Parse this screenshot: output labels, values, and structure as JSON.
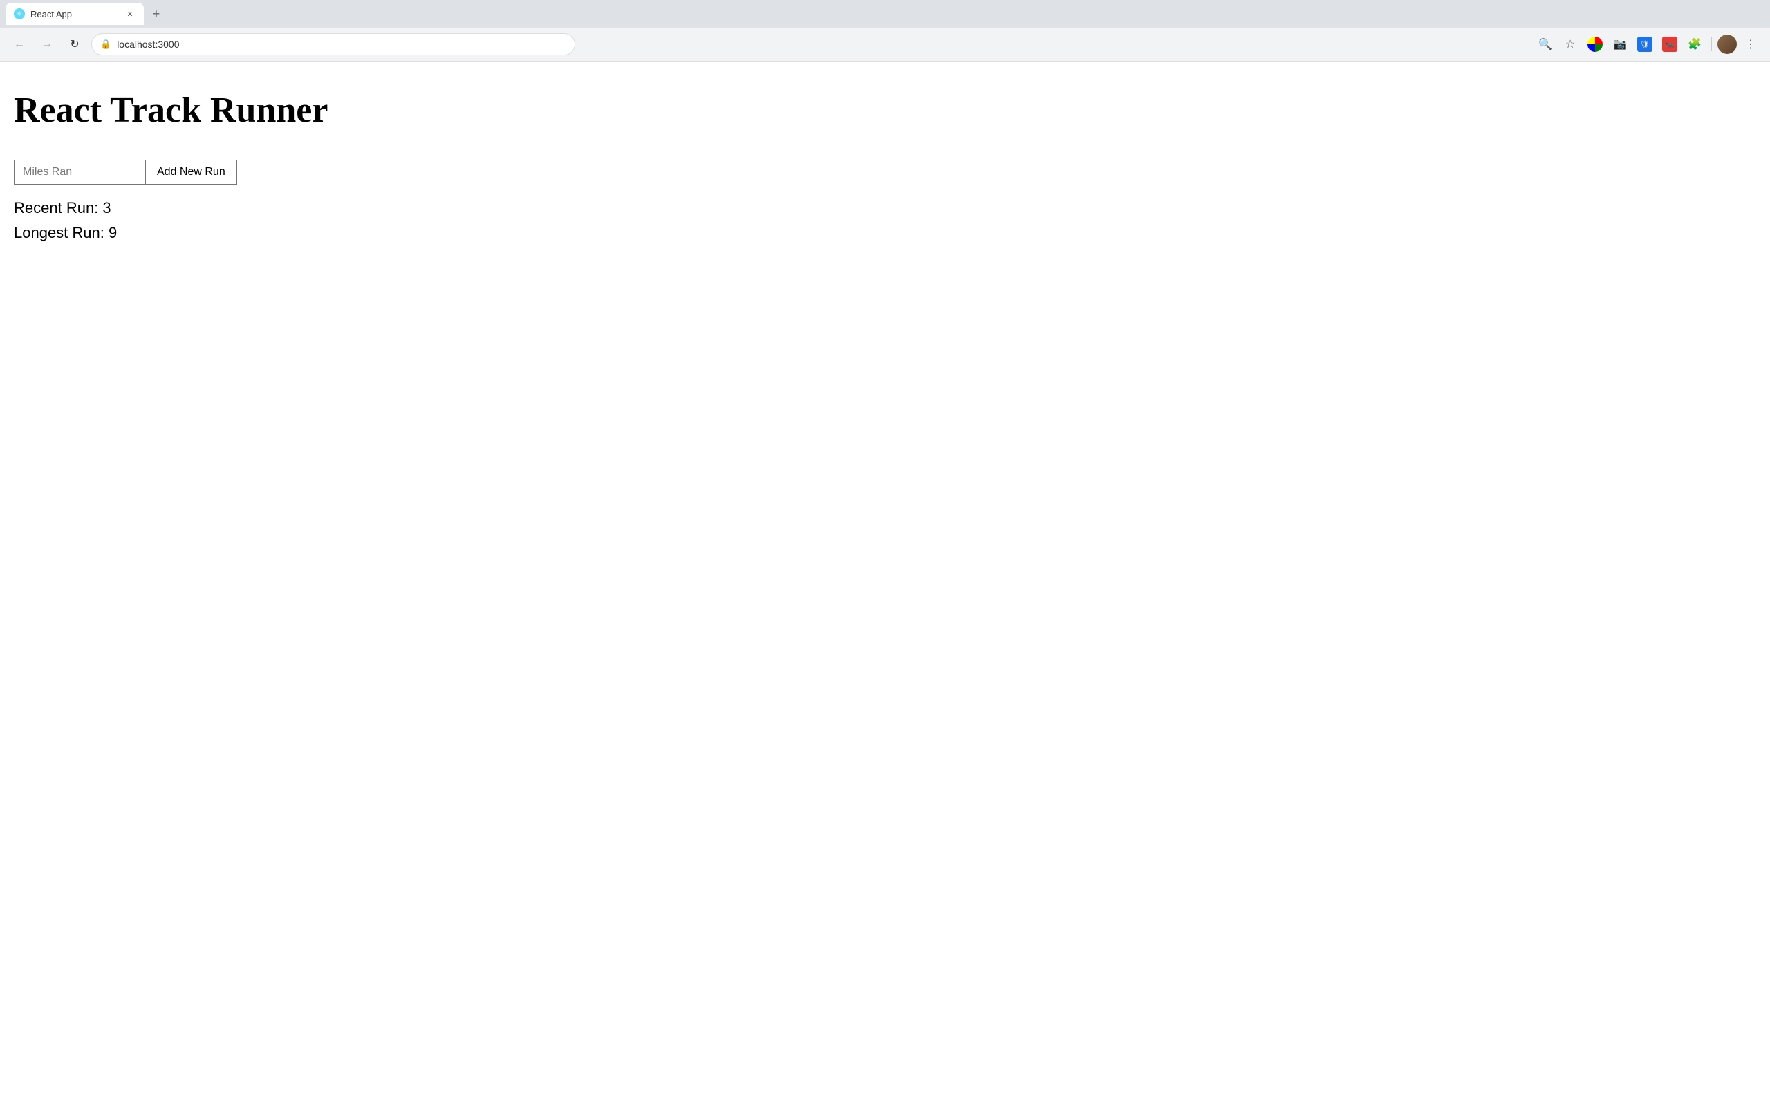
{
  "browser": {
    "tab": {
      "title": "React App",
      "favicon": "⚛"
    },
    "new_tab_label": "+",
    "address": "localhost:3000",
    "nav": {
      "back_label": "←",
      "forward_label": "→",
      "reload_label": "↻"
    }
  },
  "app": {
    "title": "React Track Runner",
    "form": {
      "input_placeholder": "Miles Ran",
      "button_label": "Add New Run"
    },
    "stats": {
      "recent_run_label": "Recent Run:",
      "recent_run_value": "3",
      "longest_run_label": "Longest Run:",
      "longest_run_value": "9"
    }
  }
}
